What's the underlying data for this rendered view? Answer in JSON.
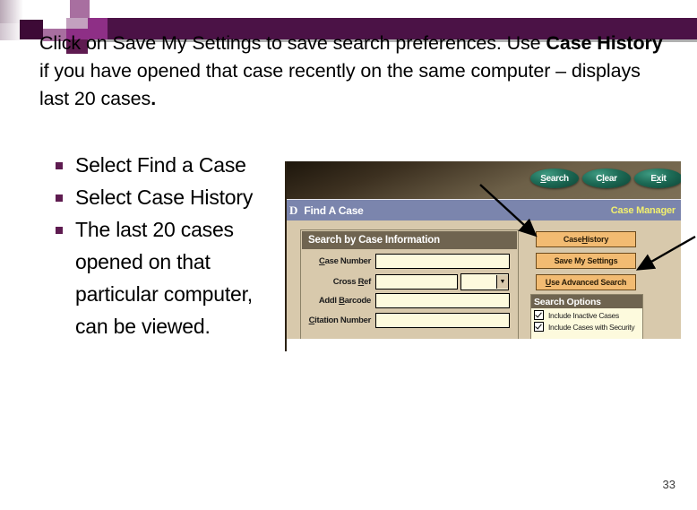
{
  "decor": {
    "name": "corner-mosaic",
    "colors": [
      "#3d0a36",
      "#7a3c72",
      "#a86fa0",
      "#4b1246",
      "#8e2f86",
      "#c3a1bf",
      "#5e1b50",
      "#ffffff"
    ]
  },
  "header": {
    "line1_a": "Click on Save My Settings to save search preferences. Use ",
    "line1_b": "Case History",
    "line1_c": " if you have opened that case recently on the same computer – displays last 20 cases",
    "line1_d": "."
  },
  "bullets": {
    "marker_color": "#5e1b50",
    "items": [
      "Select Find a Case",
      "Select  Case History",
      "The last 20 cases opened on that particular computer, can be viewed."
    ]
  },
  "app": {
    "toolbar": {
      "buttons": [
        {
          "name": "search",
          "pre": "",
          "accel": "S",
          "post": "earch"
        },
        {
          "name": "clear",
          "pre": "C",
          "accel": "l",
          "post": "ear"
        },
        {
          "name": "exit",
          "pre": "E",
          "accel": "x",
          "post": "it"
        }
      ]
    },
    "titlebar": {
      "glyph": "D",
      "title": "Find A Case",
      "right_label": "Case Manager"
    },
    "case_info": {
      "header": "Search by Case Information",
      "fields": [
        {
          "name": "case-number",
          "pre": "",
          "accel": "C",
          "post": "ase Number",
          "value": ""
        },
        {
          "name": "cross-ref",
          "pre": "Cross ",
          "accel": "R",
          "post": "ef",
          "value": "",
          "combo_value": ""
        },
        {
          "name": "addl-barcode",
          "pre": "Addl ",
          "accel": "B",
          "post": "arcode",
          "value": ""
        },
        {
          "name": "citation-number",
          "pre": "",
          "accel": "C",
          "post": "itation Number",
          "value": ""
        }
      ],
      "combo_arrow": "▼"
    },
    "side_buttons": [
      {
        "name": "case-history",
        "pre": "Case ",
        "accel": "H",
        "post": "istory"
      },
      {
        "name": "save-my-settings",
        "pre": "Save My Settings",
        "accel": "",
        "post": ""
      },
      {
        "name": "use-advanced-search",
        "pre": "",
        "accel": "U",
        "post": "se Advanced Search"
      }
    ],
    "search_options": {
      "header": "Search Options",
      "checkboxes": [
        {
          "label": "Include Inactive Cases",
          "checked": true
        },
        {
          "label": "Include Cases with Security",
          "checked": true
        }
      ]
    }
  },
  "annotations": {
    "arrow1": "arrow-to-case-history",
    "arrow2": "arrow-to-save-my-settings"
  },
  "footer": {
    "page_number": "33"
  }
}
